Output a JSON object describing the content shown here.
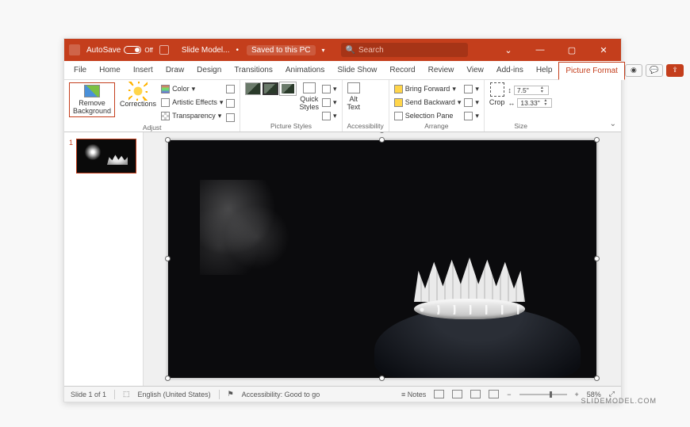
{
  "titlebar": {
    "autosave_label": "AutoSave",
    "autosave_state": "Off",
    "file_name": "Slide Model...",
    "saved_state": "Saved to this PC",
    "search_placeholder": "Search"
  },
  "tabs": {
    "items": [
      "File",
      "Home",
      "Insert",
      "Draw",
      "Design",
      "Transitions",
      "Animations",
      "Slide Show",
      "Record",
      "Review",
      "View",
      "Add-ins",
      "Help",
      "Picture Format"
    ],
    "active_index": 13
  },
  "ribbon": {
    "remove_bg": "Remove\nBackground",
    "corrections": "Corrections",
    "color": "Color",
    "artistic": "Artistic Effects",
    "transparency": "Transparency",
    "adjust_label": "Adjust",
    "quick_styles": "Quick\nStyles",
    "picture_styles_label": "Picture Styles",
    "alt_text": "Alt\nText",
    "accessibility_label": "Accessibility",
    "bring_forward": "Bring Forward",
    "send_backward": "Send Backward",
    "selection_pane": "Selection Pane",
    "arrange_label": "Arrange",
    "crop": "Crop",
    "height": "7.5\"",
    "width": "13.33\"",
    "size_label": "Size"
  },
  "thumbs": {
    "slide_number": "1"
  },
  "statusbar": {
    "slide_of": "Slide 1 of 1",
    "language": "English (United States)",
    "accessibility": "Accessibility: Good to go",
    "notes": "Notes",
    "zoom": "58%",
    "fit": "⤢"
  },
  "watermark": "SLIDEMODEL.COM"
}
